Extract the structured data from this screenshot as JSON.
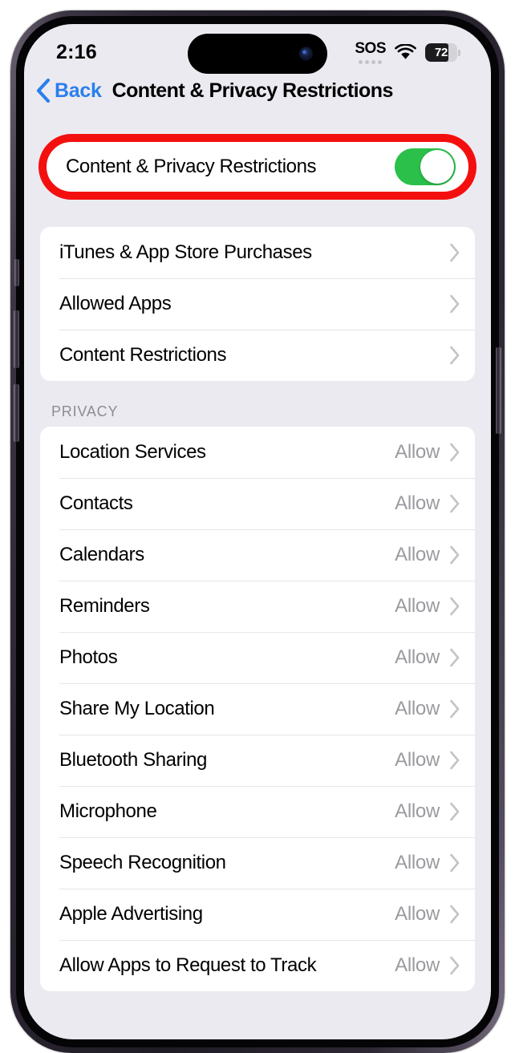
{
  "status_bar": {
    "time": "2:16",
    "sos_label": "SOS",
    "wifi_icon": "wifi-icon",
    "battery_percent": "72",
    "battery_level_value": 72
  },
  "nav": {
    "back_label": "Back",
    "back_icon": "chevron-left-icon",
    "title": "Content & Privacy Restrictions"
  },
  "highlight": {
    "color": "#f40f0f",
    "target": "content-privacy-restrictions-toggle-row"
  },
  "toggle_row": {
    "label": "Content & Privacy Restrictions",
    "state": "on",
    "on_color": "#2ac04a"
  },
  "restrictions_group": {
    "rows": [
      {
        "label": "iTunes & App Store Purchases",
        "value": "",
        "accessory": "chevron-right-icon"
      },
      {
        "label": "Allowed Apps",
        "value": "",
        "accessory": "chevron-right-icon"
      },
      {
        "label": "Content Restrictions",
        "value": "",
        "accessory": "chevron-right-icon"
      }
    ]
  },
  "privacy_section": {
    "header": "PRIVACY",
    "rows": [
      {
        "label": "Location Services",
        "value": "Allow",
        "accessory": "chevron-right-icon"
      },
      {
        "label": "Contacts",
        "value": "Allow",
        "accessory": "chevron-right-icon"
      },
      {
        "label": "Calendars",
        "value": "Allow",
        "accessory": "chevron-right-icon"
      },
      {
        "label": "Reminders",
        "value": "Allow",
        "accessory": "chevron-right-icon"
      },
      {
        "label": "Photos",
        "value": "Allow",
        "accessory": "chevron-right-icon"
      },
      {
        "label": "Share My Location",
        "value": "Allow",
        "accessory": "chevron-right-icon"
      },
      {
        "label": "Bluetooth Sharing",
        "value": "Allow",
        "accessory": "chevron-right-icon"
      },
      {
        "label": "Microphone",
        "value": "Allow",
        "accessory": "chevron-right-icon"
      },
      {
        "label": "Speech Recognition",
        "value": "Allow",
        "accessory": "chevron-right-icon"
      },
      {
        "label": "Apple Advertising",
        "value": "Allow",
        "accessory": "chevron-right-icon"
      },
      {
        "label": "Allow Apps to Request to Track",
        "value": "Allow",
        "accessory": "chevron-right-icon"
      }
    ]
  }
}
